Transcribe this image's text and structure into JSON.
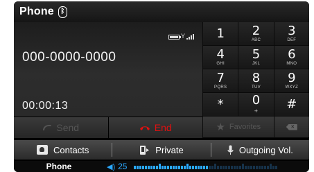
{
  "app": {
    "title": "Phone",
    "bluetooth_icon": "bluetooth-icon"
  },
  "call": {
    "number": "000-0000-0000",
    "duration": "00:00:13",
    "status_icons": [
      "battery-icon",
      "signal-icon"
    ]
  },
  "call_buttons": {
    "send_label": "Send",
    "end_label": "End"
  },
  "keypad": {
    "keys": [
      {
        "digit": "1",
        "letters": ""
      },
      {
        "digit": "2",
        "letters": "ABC"
      },
      {
        "digit": "3",
        "letters": "DEF"
      },
      {
        "digit": "4",
        "letters": "GHI"
      },
      {
        "digit": "5",
        "letters": "JKL"
      },
      {
        "digit": "6",
        "letters": "MNO"
      },
      {
        "digit": "7",
        "letters": "PQRS"
      },
      {
        "digit": "8",
        "letters": "TUV"
      },
      {
        "digit": "9",
        "letters": "WXYZ"
      },
      {
        "digit": "*",
        "letters": ""
      },
      {
        "digit": "0",
        "letters": "+"
      },
      {
        "digit": "#",
        "letters": ""
      }
    ],
    "favorites_label": "Favorites"
  },
  "bottom_bar": {
    "contacts_label": "Contacts",
    "private_label": "Private",
    "outgoing_label": "Outgoing Vol."
  },
  "status_strip": {
    "label": "Phone",
    "volume": "25",
    "volume_level_fraction": 0.52
  },
  "colors": {
    "end_red": "#e01010",
    "volume_blue": "#2aa8ff",
    "disabled_gray": "#555555"
  }
}
